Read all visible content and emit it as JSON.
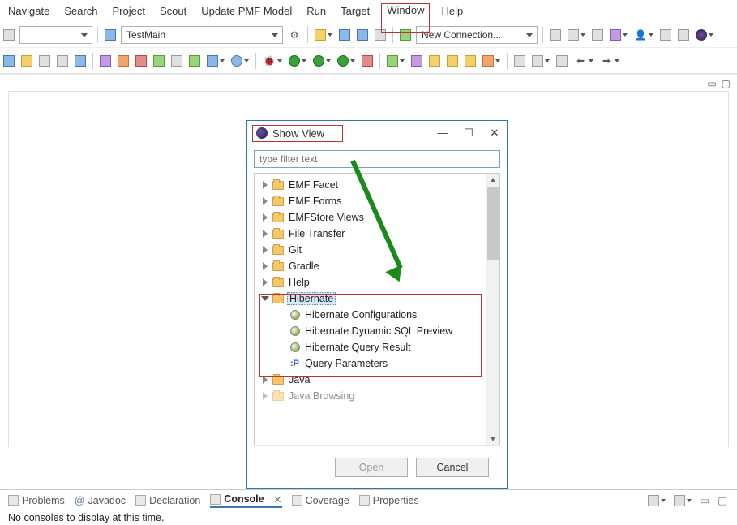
{
  "menu": {
    "items": [
      "Navigate",
      "Search",
      "Project",
      "Scout",
      "Update PMF Model",
      "Run",
      "Target",
      "Window",
      "Help"
    ]
  },
  "toolbar1": {
    "testmain": "TestMain",
    "new_connection": "New Connection..."
  },
  "dialog": {
    "title": "Show View",
    "filter_placeholder": "type filter text",
    "tree": {
      "folders": [
        "EMF Facet",
        "EMF Forms",
        "EMFStore Views",
        "File Transfer",
        "Git",
        "Gradle",
        "Help"
      ],
      "hibernate": {
        "label": "Hibernate",
        "children": [
          "Hibernate Configurations",
          "Hibernate Dynamic SQL Preview",
          "Hibernate Query Result",
          "Query Parameters"
        ]
      },
      "after": [
        "Java",
        "Java Browsing"
      ]
    },
    "open": "Open",
    "cancel": "Cancel"
  },
  "bottom": {
    "tabs": [
      "Problems",
      "Javadoc",
      "Declaration",
      "Console",
      "Coverage",
      "Properties"
    ],
    "console_close": "✕",
    "console_msg": "No consoles to display at this time."
  },
  "winbtns": {
    "min": "—",
    "max": "☐",
    "close": "✕"
  }
}
